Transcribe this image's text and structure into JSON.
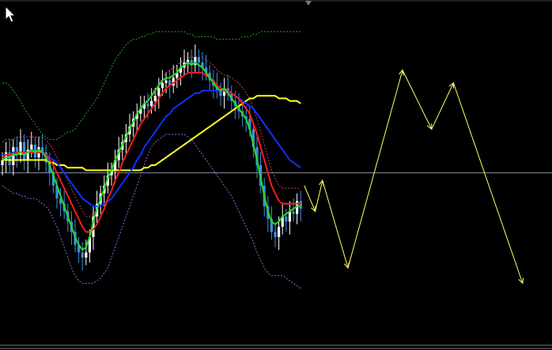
{
  "window": {
    "title": ""
  },
  "colors": {
    "background": "#000000",
    "candle_up": "#ffffff",
    "candle_down": "#3f8fe0",
    "ma_red": "#ff1a1a",
    "ma_green": "#22dd22",
    "ma_blue": "#1030ff",
    "ma_yellow": "#ffff22",
    "envelope_green": "#22aa22",
    "envelope_violet": "#8c6cdc",
    "envelope_red": "#c0407a",
    "forecast": "#ffff66",
    "horizontal_line": "#8c96a8",
    "cursor": "#ffffff"
  },
  "icons": {
    "cursor": "arrow-cursor-icon"
  },
  "chart_data": {
    "type": "candlestick",
    "title": "",
    "xlabel": "",
    "ylabel": "",
    "ylim": [
      0,
      100
    ],
    "grid": false,
    "legend": "none",
    "horizontal_line_level": 45,
    "closes": [
      50,
      53,
      48,
      55,
      52,
      57,
      50,
      54,
      56,
      51,
      55,
      53,
      49,
      45,
      40,
      35,
      33,
      30,
      26,
      22,
      17,
      14,
      12,
      14,
      20,
      28,
      33,
      37,
      40,
      44,
      46,
      50,
      54,
      57,
      60,
      63,
      66,
      68,
      70,
      72,
      71,
      73,
      75,
      78,
      80,
      81,
      79,
      82,
      84,
      86,
      88,
      89,
      87,
      90,
      88,
      86,
      84,
      81,
      79,
      77,
      75,
      78,
      76,
      73,
      71,
      69,
      67,
      66,
      62,
      55,
      48,
      40,
      32,
      27,
      22,
      20,
      24,
      28,
      26,
      30,
      29,
      34,
      31
    ],
    "ma_fast": [
      50,
      51,
      51,
      52,
      52,
      53,
      52,
      53,
      54,
      53,
      54,
      53,
      51,
      48,
      44,
      40,
      36,
      32,
      28,
      24,
      20,
      17,
      15,
      16,
      20,
      26,
      31,
      35,
      39,
      43,
      46,
      50,
      53,
      56,
      59,
      62,
      65,
      68,
      70,
      72,
      73,
      75,
      77,
      79,
      81,
      82,
      82,
      83,
      84,
      86,
      87,
      88,
      87,
      88,
      87,
      86,
      84,
      82,
      80,
      78,
      77,
      78,
      76,
      74,
      72,
      70,
      68,
      66,
      62,
      56,
      50,
      43,
      36,
      30,
      26,
      25,
      26,
      28,
      29,
      30,
      31,
      32,
      32
    ],
    "ma_mid": [
      51,
      52,
      52,
      52,
      53,
      53,
      53,
      53,
      53,
      53,
      53,
      53,
      52,
      50,
      48,
      45,
      42,
      39,
      36,
      33,
      30,
      27,
      24,
      22,
      22,
      23,
      25,
      28,
      31,
      35,
      38,
      42,
      45,
      49,
      52,
      55,
      58,
      61,
      64,
      66,
      68,
      70,
      72,
      74,
      76,
      78,
      79,
      80,
      81,
      82,
      83,
      84,
      84,
      84,
      84,
      84,
      83,
      82,
      81,
      79,
      78,
      77,
      77,
      76,
      75,
      74,
      72,
      70,
      68,
      64,
      60,
      55,
      50,
      45,
      40,
      37,
      34,
      33,
      33,
      33,
      33,
      33,
      33
    ],
    "ma_slow": [
      52,
      52,
      52,
      53,
      53,
      53,
      53,
      53,
      53,
      53,
      53,
      53,
      52,
      51,
      50,
      49,
      47,
      45,
      43,
      41,
      39,
      37,
      35,
      34,
      33,
      32,
      32,
      32,
      33,
      34,
      35,
      37,
      39,
      41,
      43,
      45,
      47,
      50,
      52,
      55,
      57,
      59,
      61,
      63,
      65,
      67,
      68,
      70,
      71,
      72,
      73,
      74,
      75,
      76,
      76,
      77,
      77,
      77,
      77,
      77,
      77,
      77,
      76,
      76,
      75,
      74,
      73,
      72,
      71,
      70,
      68,
      66,
      64,
      62,
      60,
      58,
      56,
      54,
      52,
      50,
      49,
      48,
      47
    ],
    "ma_trend": [
      50,
      50,
      50,
      50,
      50,
      50,
      50,
      50,
      50,
      50,
      50,
      50,
      50,
      49,
      49,
      48,
      48,
      48,
      47,
      47,
      47,
      47,
      47,
      46,
      46,
      46,
      46,
      46,
      46,
      46,
      46,
      46,
      46,
      46,
      46,
      46,
      46,
      46,
      46,
      47,
      47,
      48,
      48,
      49,
      50,
      51,
      52,
      53,
      54,
      55,
      56,
      57,
      58,
      59,
      60,
      61,
      62,
      63,
      64,
      65,
      66,
      67,
      68,
      69,
      70,
      71,
      72,
      73,
      74,
      74,
      75,
      75,
      75,
      75,
      75,
      75,
      74,
      74,
      74,
      73,
      73,
      73,
      72
    ],
    "envelope_upper": [
      80,
      80,
      79,
      77,
      75,
      73,
      70,
      68,
      66,
      64,
      62,
      60,
      59,
      58,
      58,
      58,
      59,
      60,
      61,
      61,
      62,
      64,
      66,
      68,
      70,
      72,
      74,
      77,
      80,
      83,
      86,
      89,
      91,
      93,
      95,
      96,
      97,
      97,
      98,
      98,
      99,
      99,
      100,
      100,
      100,
      100,
      100,
      100,
      100,
      100,
      100,
      99,
      99,
      98,
      98,
      98,
      98,
      98,
      98,
      97,
      97,
      97,
      97,
      97,
      97,
      97,
      98,
      98,
      98,
      99,
      99,
      100,
      100,
      100,
      100,
      100,
      100,
      100,
      100,
      100,
      100,
      100,
      100
    ],
    "envelope_lower": [
      40,
      39,
      38,
      37,
      37,
      36,
      36,
      35,
      35,
      35,
      34,
      33,
      32,
      30,
      27,
      24,
      20,
      16,
      12,
      8,
      5,
      3,
      2,
      2,
      2,
      2,
      3,
      4,
      6,
      8,
      12,
      16,
      20,
      24,
      28,
      32,
      36,
      40,
      44,
      48,
      52,
      55,
      57,
      58,
      59,
      60,
      60,
      60,
      60,
      60,
      60,
      59,
      58,
      56,
      54,
      52,
      50,
      48,
      46,
      44,
      42,
      40,
      38,
      36,
      33,
      30,
      27,
      24,
      21,
      18,
      14,
      11,
      8,
      6,
      5,
      5,
      5,
      5,
      4,
      3,
      2,
      1,
      0
    ],
    "forecast": [
      {
        "bar": 83,
        "value": 40
      },
      {
        "bar": 86,
        "value": 30
      },
      {
        "bar": 88,
        "value": 42
      },
      {
        "bar": 95,
        "value": 8
      },
      {
        "bar": 110,
        "value": 85
      },
      {
        "bar": 118,
        "value": 62
      },
      {
        "bar": 124,
        "value": 80
      },
      {
        "bar": 143,
        "value": 2
      }
    ]
  }
}
